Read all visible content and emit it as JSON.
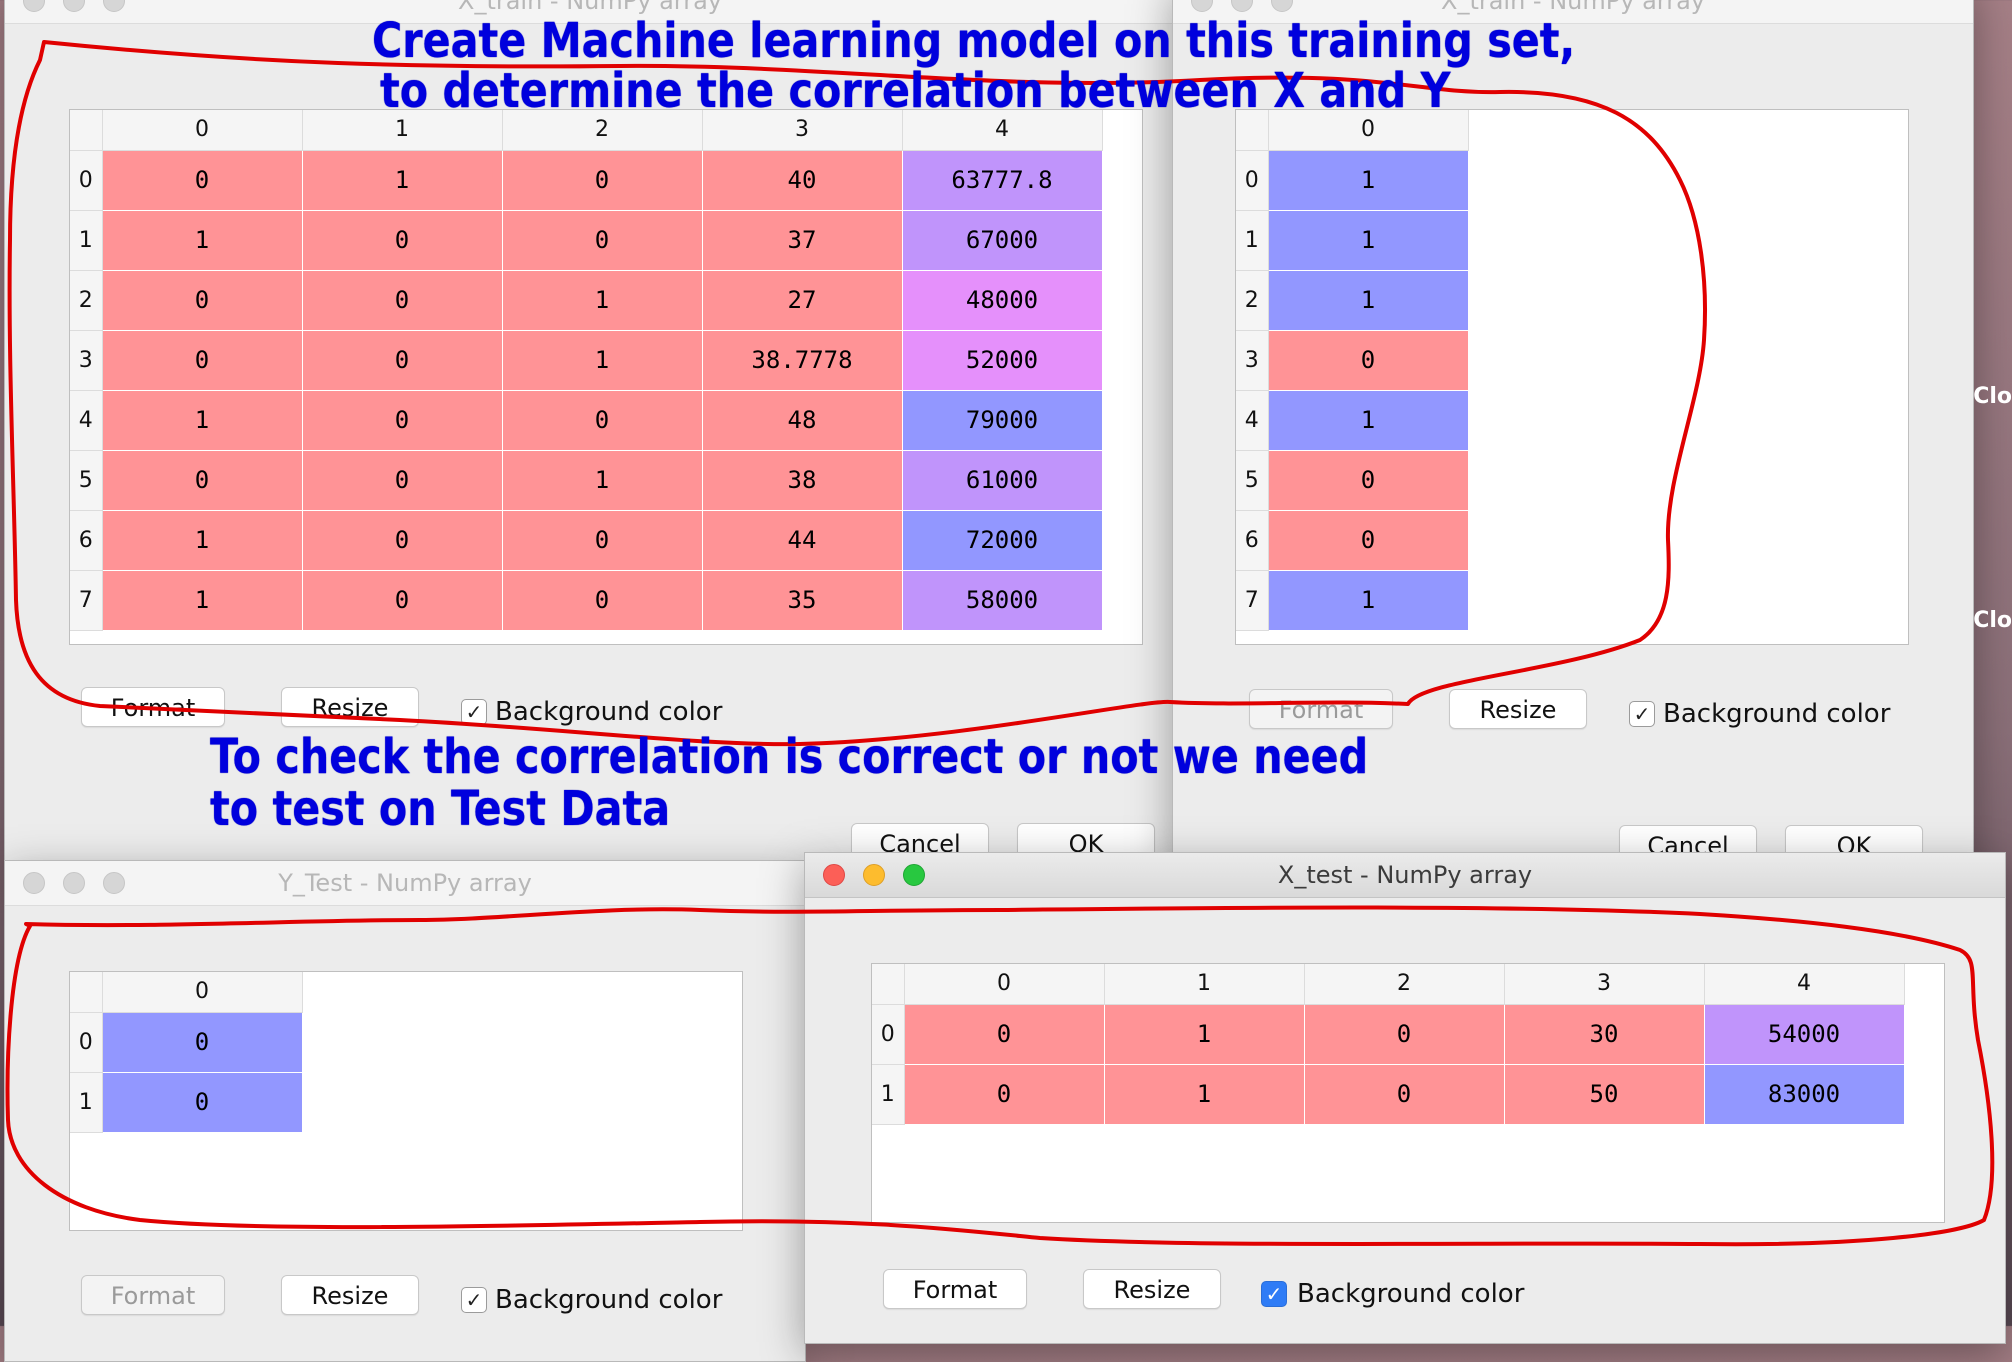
{
  "colors": {
    "salmon": "#ff9396",
    "blue": "#9297ff",
    "violet": "#c094fb",
    "light_violet": "#e590fb",
    "outline": "#e00000",
    "annotation": "#0000dd"
  },
  "xtrain_left": {
    "title": "X_train - NumPy array",
    "columns": [
      "0",
      "1",
      "2",
      "3",
      "4"
    ],
    "rows": [
      "0",
      "1",
      "2",
      "3",
      "4",
      "5",
      "6",
      "7"
    ],
    "cells": [
      [
        "0",
        "1",
        "0",
        "40",
        "63777.8"
      ],
      [
        "1",
        "0",
        "0",
        "37",
        "67000"
      ],
      [
        "0",
        "0",
        "1",
        "27",
        "48000"
      ],
      [
        "0",
        "0",
        "1",
        "38.7778",
        "52000"
      ],
      [
        "1",
        "0",
        "0",
        "48",
        "79000"
      ],
      [
        "0",
        "0",
        "1",
        "38",
        "61000"
      ],
      [
        "1",
        "0",
        "0",
        "44",
        "72000"
      ],
      [
        "1",
        "0",
        "0",
        "35",
        "58000"
      ]
    ],
    "format_label": "Format",
    "resize_label": "Resize",
    "bg_color_label": "Background color",
    "bg_color_checked": true,
    "cancel_label": "Cancel",
    "ok_label": "OK"
  },
  "xtrain_right": {
    "title": "X_train - NumPy array",
    "columns": [
      "0"
    ],
    "rows": [
      "0",
      "1",
      "2",
      "3",
      "4",
      "5",
      "6",
      "7"
    ],
    "cells": [
      [
        "1"
      ],
      [
        "1"
      ],
      [
        "1"
      ],
      [
        "0"
      ],
      [
        "1"
      ],
      [
        "0"
      ],
      [
        "0"
      ],
      [
        "1"
      ]
    ],
    "format_label": "Format",
    "resize_label": "Resize",
    "bg_color_label": "Background color",
    "bg_color_checked": true,
    "cancel_label": "Cancel",
    "ok_label": "OK"
  },
  "ytest": {
    "title": "Y_Test - NumPy array",
    "columns": [
      "0"
    ],
    "rows": [
      "0",
      "1"
    ],
    "cells": [
      [
        "0"
      ],
      [
        "0"
      ]
    ],
    "format_label": "Format",
    "resize_label": "Resize",
    "bg_color_label": "Background color",
    "bg_color_checked": true
  },
  "xtest": {
    "title": "X_test - NumPy array",
    "columns": [
      "0",
      "1",
      "2",
      "3",
      "4"
    ],
    "rows": [
      "0",
      "1"
    ],
    "cells": [
      [
        "0",
        "1",
        "0",
        "30",
        "54000"
      ],
      [
        "0",
        "1",
        "0",
        "50",
        "83000"
      ]
    ],
    "format_label": "Format",
    "resize_label": "Resize",
    "bg_color_label": "Background color",
    "bg_color_checked": true
  },
  "annotations": {
    "top_line1": "Create Machine learning model on this training set,",
    "top_line2": "to determine the correlation between X and Y",
    "mid_line1": "To check the correlation is correct or not we need",
    "mid_line2": "to test on Test Data"
  },
  "edge_labels": [
    "Clo",
    "Clo"
  ]
}
